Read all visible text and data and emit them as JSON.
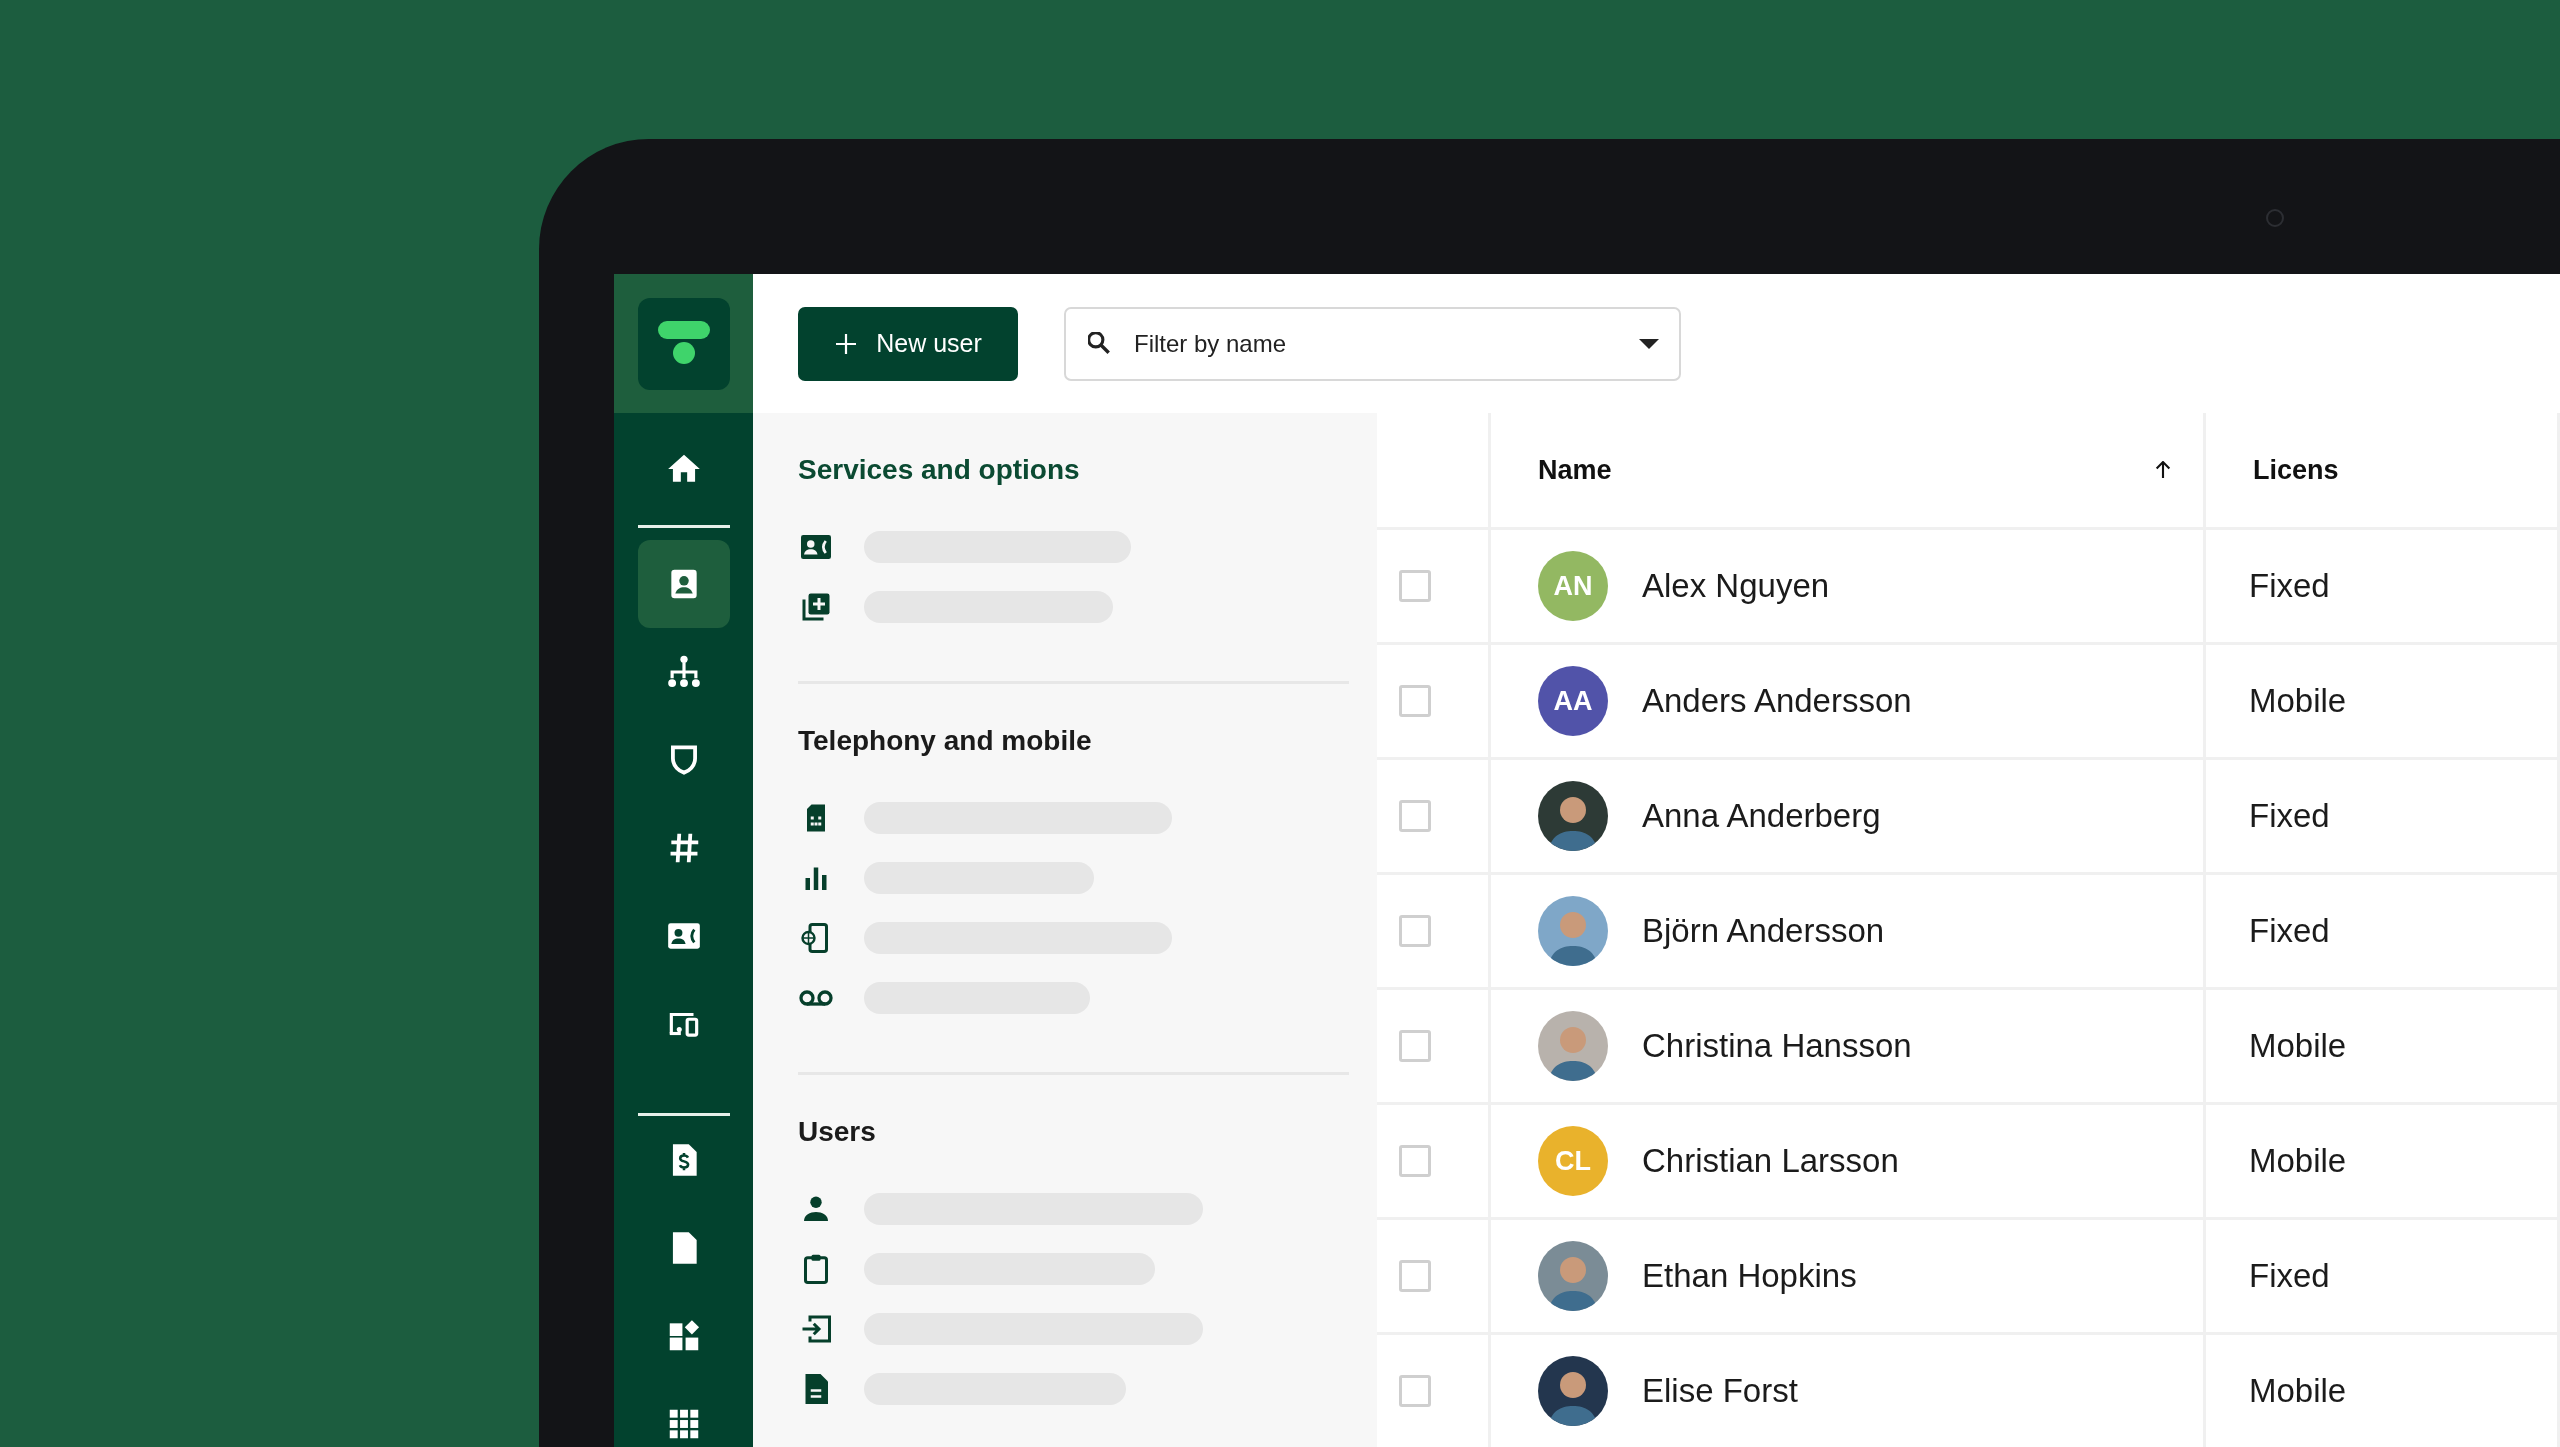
{
  "toolbar": {
    "new_user_button": "New user",
    "filter": {
      "placeholder": "Filter by name"
    }
  },
  "sidebar": {
    "groups": [
      {
        "items": [
          {
            "selected": false
          }
        ]
      },
      {
        "items": [
          {
            "selected": true
          },
          {
            "selected": false
          },
          {
            "selected": false
          },
          {
            "selected": false
          },
          {
            "selected": false
          },
          {
            "selected": false
          }
        ]
      },
      {
        "items": [
          {
            "selected": false
          },
          {
            "selected": false
          },
          {
            "selected": false
          },
          {
            "selected": false
          }
        ]
      }
    ]
  },
  "panel": {
    "sections": [
      {
        "title": "Services and options",
        "selected": true,
        "items": [
          {
            "kind": "placeholder"
          },
          {
            "kind": "placeholder"
          }
        ]
      },
      {
        "title": "Telephony and mobile",
        "selected": false,
        "items": [
          {
            "kind": "placeholder"
          },
          {
            "kind": "placeholder"
          },
          {
            "kind": "placeholder"
          },
          {
            "kind": "placeholder"
          }
        ]
      },
      {
        "title": "Users",
        "selected": false,
        "items": [
          {
            "kind": "placeholder"
          },
          {
            "kind": "placeholder"
          },
          {
            "kind": "placeholder"
          },
          {
            "kind": "placeholder"
          }
        ]
      }
    ]
  },
  "table": {
    "columns": [
      {
        "label": "Name",
        "sort_ascending": true
      },
      {
        "label": "Licens",
        "sort_ascending": false
      }
    ],
    "rows": [
      {
        "checked": false,
        "avatar": {
          "kind": "initials",
          "initials": "AN",
          "color": "#93b862"
        },
        "name": "Alex Nguyen",
        "license": "Fixed"
      },
      {
        "checked": false,
        "avatar": {
          "kind": "initials",
          "initials": "AA",
          "color": "#5153a9"
        },
        "name": "Anders Andersson",
        "license": "Mobile"
      },
      {
        "checked": false,
        "name": "Anna Anderberg",
        "license": "Fixed"
      },
      {
        "checked": false,
        "name": "Björn Andersson",
        "license": "Fixed"
      },
      {
        "checked": false,
        "name": "Christina Hansson",
        "license": "Mobile"
      },
      {
        "checked": false,
        "avatar": {
          "kind": "initials",
          "initials": "CL",
          "color": "#e9b22c"
        },
        "name": "Christian Larsson",
        "license": "Mobile"
      },
      {
        "checked": false,
        "name": "Ethan Hopkins",
        "license": "Fixed"
      },
      {
        "checked": false,
        "name": "Elise Forst",
        "license": "Mobile"
      }
    ]
  }
}
